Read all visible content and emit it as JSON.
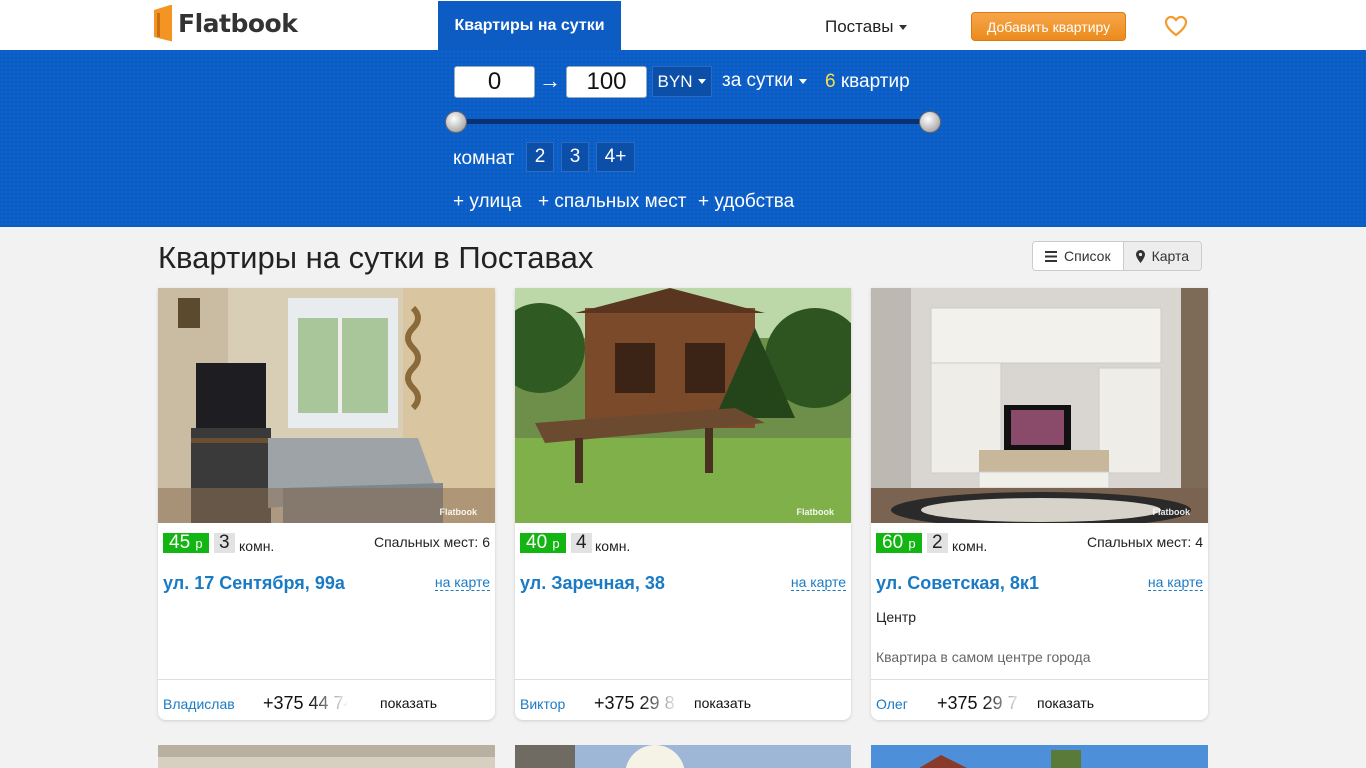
{
  "header": {
    "logo": "Flatbook",
    "nav_active": "Квартиры на сутки",
    "city": "Поставы",
    "add_button": "Добавить квартиру",
    "favorites_icon": "heart-icon"
  },
  "filter": {
    "price_min": "0",
    "price_max": "100",
    "arrow": "→",
    "currency": "BYN",
    "period": "за сутки",
    "count_num": "6",
    "count_label": "квартир",
    "slider": {
      "min": 0,
      "max": 100
    },
    "rooms_label": "комнат",
    "rooms_options": [
      "2",
      "3",
      "4+"
    ],
    "extras": [
      "+ улица",
      "+ спальных мест",
      "+ удобства"
    ]
  },
  "main": {
    "title": "Квартиры на сутки в Поставах",
    "view_list": "Список",
    "view_map": "Карта"
  },
  "listings": [
    {
      "price": "45",
      "currency_short": "р",
      "rooms": "3",
      "rooms_unit": "комн.",
      "beds": "Спальных мест: 6",
      "address": "ул. 17 Сентября, 99а",
      "map_link": "на карте",
      "district": "",
      "description": "",
      "owner": "Владислав",
      "phone": "+375 44 74",
      "show": "показать",
      "watermark": "Flatbook"
    },
    {
      "price": "40",
      "currency_short": "р",
      "rooms": "4",
      "rooms_unit": "комн.",
      "beds": "",
      "address": "ул. Заречная, 38",
      "map_link": "на карте",
      "district": "",
      "description": "",
      "owner": "Виктор",
      "phone": "+375 29 8",
      "show": "показать",
      "watermark": "Flatbook"
    },
    {
      "price": "60",
      "currency_short": "р",
      "rooms": "2",
      "rooms_unit": "комн.",
      "beds": "Спальных мест: 4",
      "address": "ул. Советская, 8к1",
      "map_link": "на карте",
      "district": "Центр",
      "description": "Квартира в самом центре города",
      "owner": "Олег",
      "phone": "+375 29 7",
      "show": "показать",
      "watermark": "Flatbook"
    }
  ]
}
